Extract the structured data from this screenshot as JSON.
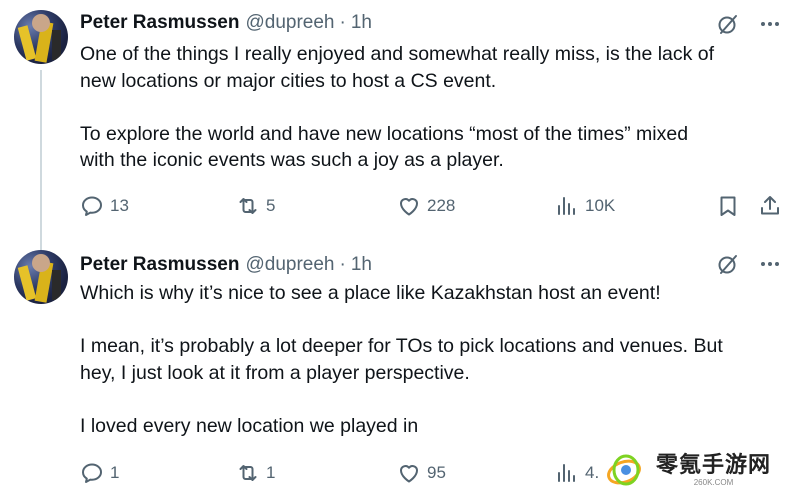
{
  "tweets": [
    {
      "name": "Peter Rasmussen",
      "handle": "@dupreeh",
      "separator": "·",
      "time": "1h",
      "paragraphs": [
        [
          "One of the things I really enjoyed and somewhat really miss, is the lack of",
          "new locations or major cities to host a CS event."
        ],
        [
          "To explore the world and have new locations “most of the times” mixed",
          "with the iconic events was such a joy as a player."
        ]
      ],
      "stats": {
        "replies": "13",
        "retweets": "5",
        "likes": "228",
        "views": "10K"
      }
    },
    {
      "name": "Peter Rasmussen",
      "handle": "@dupreeh",
      "separator": "·",
      "time": "1h",
      "paragraphs": [
        [
          "Which is why it’s nice to see a place like Kazakhstan host an event!"
        ],
        [
          "I mean, it’s probably a lot deeper for TOs to pick locations and venues. But",
          "hey, I just look at it from a player perspective."
        ],
        [
          "I loved every new location we played in"
        ]
      ],
      "stats": {
        "replies": "1",
        "retweets": "1",
        "likes": "95",
        "views": "4."
      }
    }
  ],
  "icons": [
    "grok-slash-icon",
    "more-icon",
    "reply-icon",
    "retweet-icon",
    "like-icon",
    "views-icon",
    "bookmark-icon",
    "share-icon"
  ],
  "colors": {
    "text": "#0f1419",
    "secondary": "#536471",
    "thread_line": "#cfd9de"
  },
  "watermark": {
    "title": "零氪手游网",
    "subtitle": "260K.COM"
  }
}
